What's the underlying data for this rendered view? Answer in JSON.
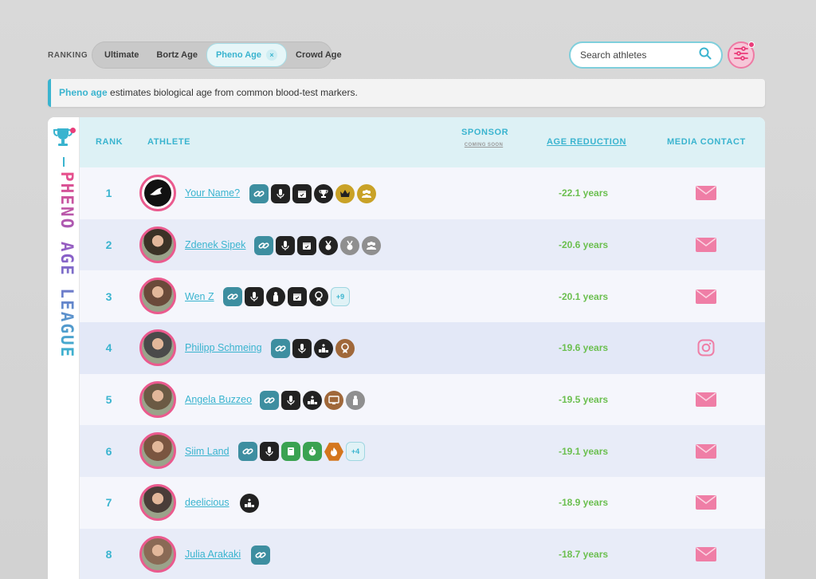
{
  "ranking": {
    "label": "RANKING",
    "tabs": [
      {
        "label": "Ultimate",
        "active": false
      },
      {
        "label": "Bortz Age",
        "active": false
      },
      {
        "label": "Pheno Age",
        "active": true
      },
      {
        "label": "Crowd Age",
        "active": false
      }
    ],
    "active_close": "×"
  },
  "search": {
    "placeholder": "Search athletes"
  },
  "info": {
    "highlight": "Pheno age",
    "text": " estimates biological age from common blood-test markers."
  },
  "league": {
    "title": "PHENO AGE LEAGUE"
  },
  "table": {
    "headers": {
      "rank": "RANK",
      "athlete": "ATHLETE",
      "sponsor": "SPONSOR",
      "sponsor_note": "COMING SOON",
      "age_reduction": "AGE REDUCTION",
      "media_contact": "MEDIA CONTACT"
    },
    "rows": [
      {
        "rank": "1",
        "name": "Your Name?",
        "reduction": "-22.1 years",
        "contact": "email",
        "badges": [
          {
            "k": "link",
            "icon": "link-icon"
          },
          {
            "k": "sq",
            "icon": "microphone-icon"
          },
          {
            "k": "sq",
            "icon": "calendar-icon"
          },
          {
            "k": "",
            "icon": "trophy-icon"
          },
          {
            "k": "gold",
            "icon": "crown-icon"
          },
          {
            "k": "gold",
            "icon": "group-icon"
          }
        ]
      },
      {
        "rank": "2",
        "name": "Zdenek Sipek",
        "reduction": "-20.6 years",
        "contact": "email",
        "badges": [
          {
            "k": "link",
            "icon": "link-icon"
          },
          {
            "k": "sq",
            "icon": "microphone-icon"
          },
          {
            "k": "sq",
            "icon": "calendar-icon"
          },
          {
            "k": "",
            "icon": "medal-icon"
          },
          {
            "k": "silver",
            "icon": "medal-icon"
          },
          {
            "k": "silver",
            "icon": "group-icon"
          }
        ]
      },
      {
        "rank": "3",
        "name": "Wen Z",
        "reduction": "-20.1 years",
        "contact": "email",
        "badges": [
          {
            "k": "link",
            "icon": "link-icon"
          },
          {
            "k": "sq",
            "icon": "microphone-icon"
          },
          {
            "k": "",
            "icon": "person-icon"
          },
          {
            "k": "sq",
            "icon": "calendar-icon"
          },
          {
            "k": "",
            "icon": "award-icon"
          },
          {
            "k": "more",
            "text": "+9"
          }
        ]
      },
      {
        "rank": "4",
        "name": "Philipp Schmeing",
        "reduction": "-19.6 years",
        "contact": "instagram",
        "badges": [
          {
            "k": "link",
            "icon": "link-icon"
          },
          {
            "k": "sq",
            "icon": "microphone-icon"
          },
          {
            "k": "",
            "icon": "podium-icon"
          },
          {
            "k": "bronze",
            "icon": "award-icon"
          }
        ]
      },
      {
        "rank": "5",
        "name": "Angela Buzzeo",
        "reduction": "-19.5 years",
        "contact": "email",
        "badges": [
          {
            "k": "link",
            "icon": "link-icon"
          },
          {
            "k": "sq",
            "icon": "microphone-icon"
          },
          {
            "k": "",
            "icon": "podium-icon"
          },
          {
            "k": "bronze",
            "icon": "monitor-icon"
          },
          {
            "k": "silver",
            "icon": "person-icon"
          }
        ]
      },
      {
        "rank": "6",
        "name": "Siim Land",
        "reduction": "-19.1 years",
        "contact": "email",
        "badges": [
          {
            "k": "link",
            "icon": "link-icon"
          },
          {
            "k": "sq",
            "icon": "microphone-icon"
          },
          {
            "k": "green",
            "icon": "book-icon"
          },
          {
            "k": "green",
            "icon": "stopwatch-icon"
          },
          {
            "k": "hex",
            "icon": "fire-icon"
          },
          {
            "k": "more",
            "text": "+4"
          }
        ]
      },
      {
        "rank": "7",
        "name": "deelicious",
        "reduction": "-18.9 years",
        "contact": "email",
        "badges": [
          {
            "k": "",
            "icon": "podium-icon"
          }
        ]
      },
      {
        "rank": "8",
        "name": "Julia Arakaki",
        "reduction": "-18.7 years",
        "contact": "email",
        "badges": [
          {
            "k": "link",
            "icon": "link-icon"
          }
        ]
      }
    ]
  },
  "colors": {
    "accent": "#3ab4cf",
    "pink": "#ea5a8e",
    "green": "#6bbf4f"
  }
}
